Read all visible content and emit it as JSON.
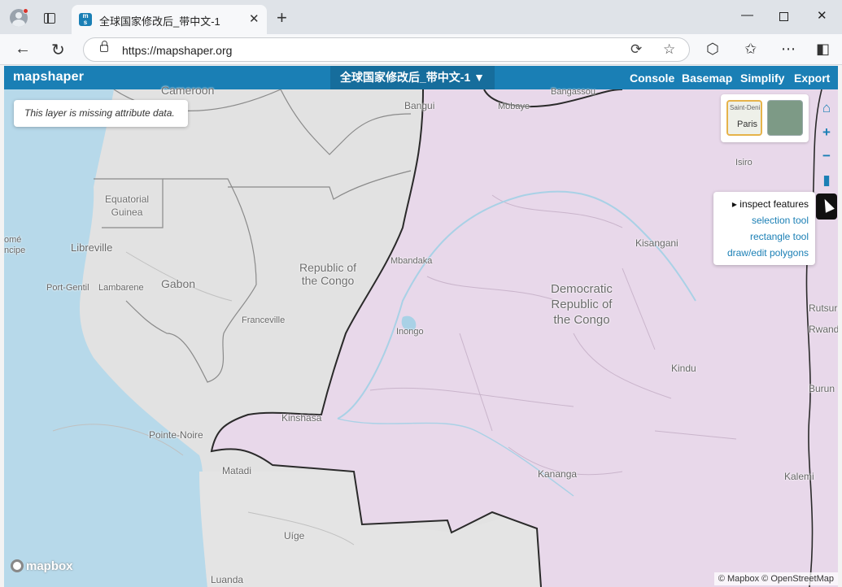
{
  "browser": {
    "tab_title": "全球国家修改后_带中文-1",
    "favicon_text": "ms",
    "url": "https://mapshaper.org",
    "icons": [
      "profile-icon",
      "tab-actions-icon",
      "close-tab-icon",
      "new-tab-icon",
      "minimize-icon",
      "maximize-icon",
      "close-window-icon",
      "back-icon",
      "refresh-icon",
      "lock-icon",
      "browser-essentials-icon",
      "favorite-star-icon",
      "extensions-icon",
      "favorites-icon",
      "more-icon",
      "sidebar-icon"
    ]
  },
  "app": {
    "logo": "mapshaper",
    "layer_name": "全球国家修改后_带中文-1 ▼",
    "menu": [
      "Console",
      "Basemap",
      "Simplify",
      "Export"
    ],
    "notice": "This layer is missing attribute data.",
    "basemap_thumbs": [
      {
        "name": "streets",
        "label_top": "Saint-Deni",
        "label_main": "Paris"
      },
      {
        "name": "satellite"
      }
    ],
    "nav_icons": [
      "home-icon",
      "zoom-in-icon",
      "zoom-out-icon",
      "bookmark-icon",
      "pointer-icon"
    ],
    "tool_menu": {
      "active": "▸ inspect features",
      "options": [
        "selection tool",
        "rectangle tool",
        "draw/edit polygons"
      ]
    },
    "mapbox_logo": "mapbox",
    "attribution": "© Mapbox © OpenStreetMap",
    "colors": {
      "header": "#1a7fb5",
      "drc_fill": "#e8d8ea",
      "ocean": "#b7d9ea",
      "land": "#e2e2e2"
    }
  },
  "map_labels": {
    "cameroon": "Cameroon",
    "bangui": "Bangui",
    "mobaye": "Mobaye",
    "bangassou": "Bangassou",
    "isiro": "Isiro",
    "equatorial_guinea": "Equatorial\nGuinea",
    "libreville": "Libreville",
    "sao_tome": "omé\nncipe",
    "port_gentil": "Port-Gentil",
    "lambarene": "Lambarene",
    "gabon": "Gabon",
    "franceville": "Franceville",
    "rep_congo": "Republic of\nthe Congo",
    "mbandaka": "Mbandaka",
    "inongo": "Inongo",
    "drc": "Democratic\nRepublic of\nthe Congo",
    "kisangani": "Kisangani",
    "rutshuru": "Rutsuru",
    "rwanda": "Rwand",
    "burundi": "Burun",
    "kindu": "Kindu",
    "kalemie": "Kalemi",
    "kinshasa": "Kinshasa",
    "pointe_noire": "Pointe-Noire",
    "matadi": "Matadi",
    "kananga": "Kananga",
    "uige": "Uíge",
    "luanda": "Luanda"
  }
}
